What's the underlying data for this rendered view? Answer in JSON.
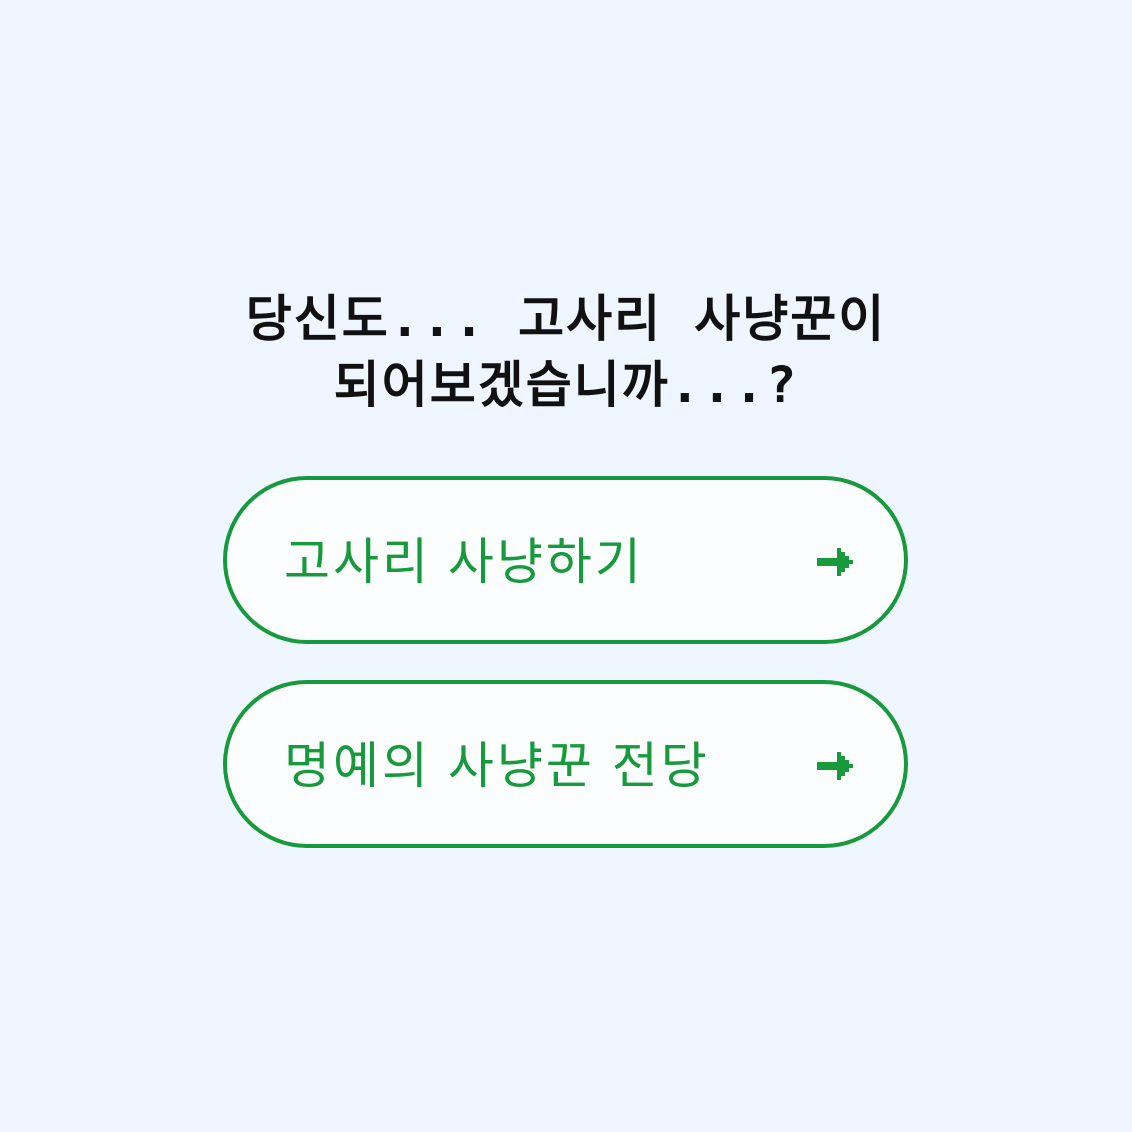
{
  "screen": {
    "prompt": {
      "line1": "당신도... 고사리 사냥꾼이",
      "line2": "되어보겠습니까...?"
    }
  },
  "buttons": [
    {
      "label": "고사리 사냥하기",
      "icon": "arrow-right-icon"
    },
    {
      "label": "명예의 사냥꾼 전당",
      "icon": "arrow-right-icon"
    }
  ],
  "colors": {
    "background": "#eff6ff",
    "text": "#111111",
    "accent": "#169a3c",
    "button_fill": "#fbfdff"
  }
}
